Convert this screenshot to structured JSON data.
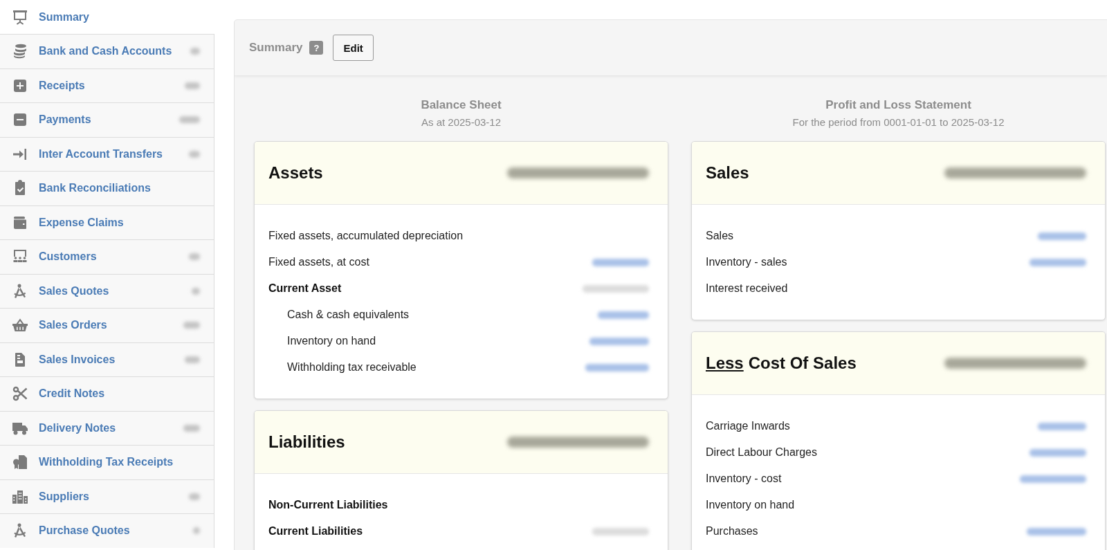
{
  "sidebar": {
    "items": [
      {
        "label": "Summary",
        "selected": true,
        "count_blurred": false
      },
      {
        "label": "Bank and Cash Accounts",
        "selected": false,
        "count_blurred": true
      },
      {
        "label": "Receipts",
        "selected": false,
        "count_blurred": true
      },
      {
        "label": "Payments",
        "selected": false,
        "count_blurred": true
      },
      {
        "label": "Inter Account Transfers",
        "selected": false,
        "count_blurred": true
      },
      {
        "label": "Bank Reconciliations",
        "selected": false,
        "count_blurred": false
      },
      {
        "label": "Expense Claims",
        "selected": false,
        "count_blurred": false
      },
      {
        "label": "Customers",
        "selected": false,
        "count_blurred": true
      },
      {
        "label": "Sales Quotes",
        "selected": false,
        "count_blurred": true
      },
      {
        "label": "Sales Orders",
        "selected": false,
        "count_blurred": true
      },
      {
        "label": "Sales Invoices",
        "selected": false,
        "count_blurred": true
      },
      {
        "label": "Credit Notes",
        "selected": false,
        "count_blurred": false
      },
      {
        "label": "Delivery Notes",
        "selected": false,
        "count_blurred": true
      },
      {
        "label": "Withholding Tax Receipts",
        "selected": false,
        "count_blurred": false
      },
      {
        "label": "Suppliers",
        "selected": false,
        "count_blurred": true
      },
      {
        "label": "Purchase Quotes",
        "selected": false,
        "count_blurred": true
      }
    ]
  },
  "header": {
    "title": "Summary",
    "help": "?",
    "edit_button": "Edit"
  },
  "columns": [
    {
      "title": "Balance Sheet",
      "subtitle": "As at 2025-03-12",
      "cards": [
        {
          "title": "Assets",
          "total_blurred": true,
          "rows": [
            {
              "label": "Fixed assets, accumulated depreciation",
              "kind": "account",
              "amount_blurred": false
            },
            {
              "label": "Fixed assets, at cost",
              "kind": "account",
              "amount_blurred": true
            },
            {
              "label": "Current Asset",
              "kind": "group",
              "amount_blurred": true,
              "children": [
                {
                  "label": "Cash & cash equivalents",
                  "kind": "account",
                  "amount_blurred": true
                },
                {
                  "label": "Inventory on hand",
                  "kind": "account",
                  "amount_blurred": true
                },
                {
                  "label": "Withholding tax receivable",
                  "kind": "account",
                  "amount_blurred": true
                }
              ]
            }
          ]
        },
        {
          "title": "Liabilities",
          "total_blurred": true,
          "rows": [
            {
              "label": "Non-Current Liabilities",
              "kind": "group",
              "amount_blurred": false
            },
            {
              "label": "Current Liabilities",
              "kind": "group",
              "amount_blurred": true
            }
          ]
        }
      ]
    },
    {
      "title": "Profit and Loss Statement",
      "subtitle": "For the period from 0001-01-01 to 2025-03-12",
      "cards": [
        {
          "title": "Sales",
          "total_blurred": true,
          "rows": [
            {
              "label": "Sales",
              "kind": "account",
              "amount_blurred": true
            },
            {
              "label": "Inventory - sales",
              "kind": "account",
              "amount_blurred": true
            },
            {
              "label": "Interest received",
              "kind": "account",
              "amount_blurred": false
            }
          ]
        },
        {
          "prefix": "Less",
          "title": "Cost Of Sales",
          "total_blurred": true,
          "rows": [
            {
              "label": "Carriage Inwards",
              "kind": "account",
              "amount_blurred": true
            },
            {
              "label": "Direct Labour Charges",
              "kind": "account",
              "amount_blurred": true
            },
            {
              "label": "Inventory - cost",
              "kind": "account",
              "amount_blurred": true
            },
            {
              "label": "Inventory on hand",
              "kind": "account",
              "amount_blurred": false
            },
            {
              "label": "Purchases",
              "kind": "account",
              "amount_blurred": true
            }
          ]
        }
      ]
    }
  ]
}
